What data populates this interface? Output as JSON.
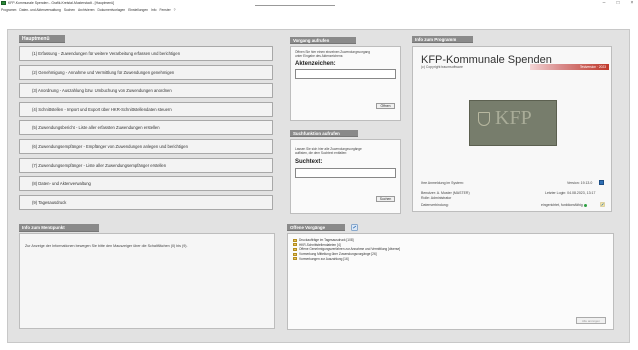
{
  "window": {
    "title": "KFP-Kommunale Spenden - Grafik-Kreistal-Musterstadt - [Hauptmenü]",
    "controls": [
      "–",
      "□",
      "×"
    ]
  },
  "menubar": [
    "Programm",
    "Daten- und Aktenverwaltung",
    "Suchen",
    "Archivieren",
    "Dokumentvorlagen",
    "Einstellungen",
    "Info",
    "Fenster",
    "?"
  ],
  "hauptmenu": {
    "header": "Hauptmenü",
    "items": [
      "(1)  Erfassung - Zuwendungen für weitere Verarbeitung erfassen und berichtigen",
      "(2)  Genehmigung - Annahme und Vermittlung für Zuwendungen genehmigen",
      "(3)  Anordnung - Auszahlung bzw. Umbuchung von Zuwendungen anordnen",
      "(4)  Schnittstellen - Import und Export über HKR-Schnittstellendaten steuern",
      "(5)  Zuwendungsbericht - Liste aller erfassten Zuwendungen erstellen",
      "(6)  Zuwendungsempfänger - Empfänger von Zuwendungen anlegen und berichtigen",
      "(7)  Zuwendungsempfänger - Liste aller Zuwendungsempfänger erstellen",
      "(8)  Daten- und Aktenverwaltung",
      "(9)  Tagesausdruck"
    ]
  },
  "info_menupunkt": {
    "header": "Info zum Menüpunkt",
    "text": "Zur Anzeige der Informationen bewegen Sie bitte den Mauszeiger über die Schaltflächen (0) bis (9)."
  },
  "vorgang": {
    "header": "Vorgang aufrufen",
    "hint_line1": "Öffnen Sie hier einen einzelnen Zuwendungsvorgang",
    "hint_line2": "unter Eingabe des Aktenzeichens:",
    "label": "Aktenzeichen:",
    "input_value": "",
    "button": "Öffnen"
  },
  "such": {
    "header": "Suchfunktion aufrufen",
    "hint_line1": "Lassen Sie sich hier alle Zuwendungsvorgänge",
    "hint_line2": "auflisten, die dem Suchtext entfallen:",
    "label": "Suchtext:",
    "input_value": "",
    "button": "Suchen"
  },
  "programm": {
    "header": "Info zum Programm",
    "title": "KFP-Kommunale Spenden",
    "subtitle": "(c) Copyright traumsoftware",
    "banner": "Testversion · 2023",
    "logo_text": "KFP",
    "anmeldung_label": "Ihre Anmeldung im System:",
    "version": "Version: 19.13.0",
    "benutzer": "Benutzer:  A. Muster (MASTER)",
    "rolle": "Rolle:  Administrator",
    "letzter_login": "Letzter Login: 04.08.2023, 13:17",
    "datenverbindung": "Datenverbindung:",
    "verbindung_status": "eingerichtet, funktionsfähig",
    "colors": {
      "banner": "#c0392b",
      "ok": "#2ea043",
      "info_icon": "#2f6fb5"
    }
  },
  "offene": {
    "header": "Offene Vorgänge",
    "items": [
      "Druckaufträge im Tagesausdruck [108]",
      "HKR-Schnittstellendateien [4]",
      "Offene Genehmigungsverfahren zur Annahme und Vermittlung [diverse]",
      "Vormerkung Mitteilung über Zuwendungsvorgänge [26]",
      "Vormerkungen zur Auszahlung [16]"
    ],
    "details_button": "Alle anzeigen"
  }
}
